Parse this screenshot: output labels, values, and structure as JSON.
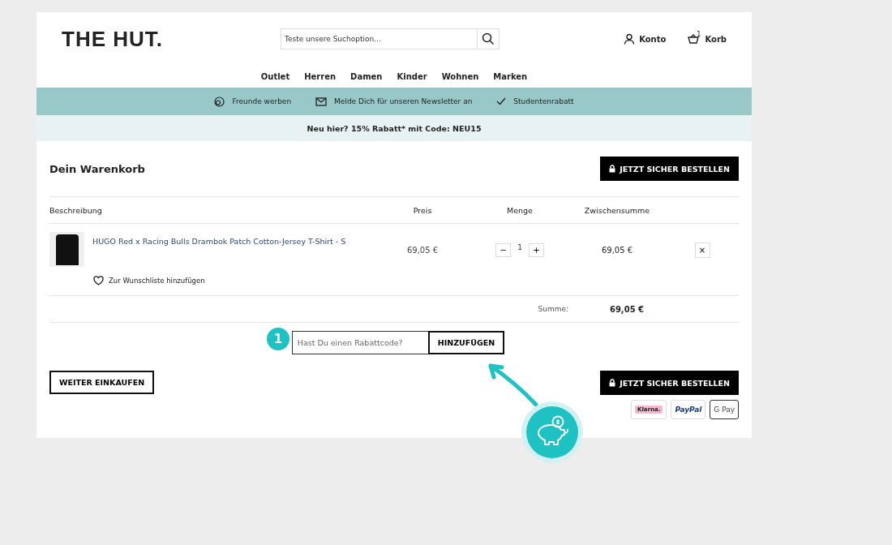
{
  "header": {
    "logo": "THE HUT.",
    "search": {
      "placeholder": "Teste unsere Suchoption..."
    },
    "account": "Konto",
    "cart": {
      "label": "Korb",
      "count": "1"
    }
  },
  "nav": [
    "Outlet",
    "Herren",
    "Damen",
    "Kinder",
    "Wohnen",
    "Marken"
  ],
  "benefits": [
    {
      "kind": "friends",
      "label": "Freunde werben"
    },
    {
      "kind": "mail",
      "label": "Melde Dich für unseren Newsletter an"
    },
    {
      "kind": "check",
      "label": "Studentenrabatt"
    }
  ],
  "promo": "Neu hier? 15% Rabatt* mit Code: NEU15",
  "cart": {
    "title": "Dein Warenkorb",
    "checkout": "JETZT SICHER BESTELLEN",
    "columns": [
      "Beschreibung",
      "Preis",
      "Menge",
      "Zwischensumme"
    ],
    "items": [
      {
        "name": "HUGO Red x Racing Bulls Drambok Patch Cotton-Jersey T-Shirt - S",
        "price": "69,05 €",
        "qty": "1",
        "minus": "−",
        "plus": "+",
        "subtotal": "69,05 €",
        "remove": "×",
        "wishlist": "Zur Wunschliste hinzufügen"
      }
    ],
    "total_label": "Summe:",
    "total": "69,05 €",
    "coupon": {
      "placeholder": "Hast Du einen Rabattcode?",
      "button": "HINZUFÜGEN",
      "step": "1"
    },
    "continue": "WEITER EINKAUFEN",
    "checkout_bottom": "JETZT SICHER BESTELLEN",
    "payments": [
      {
        "kind": "klarna",
        "label": "Klarna."
      },
      {
        "kind": "paypal",
        "label": "PayPal"
      },
      {
        "kind": "gpay",
        "label": "G Pay"
      }
    ]
  }
}
